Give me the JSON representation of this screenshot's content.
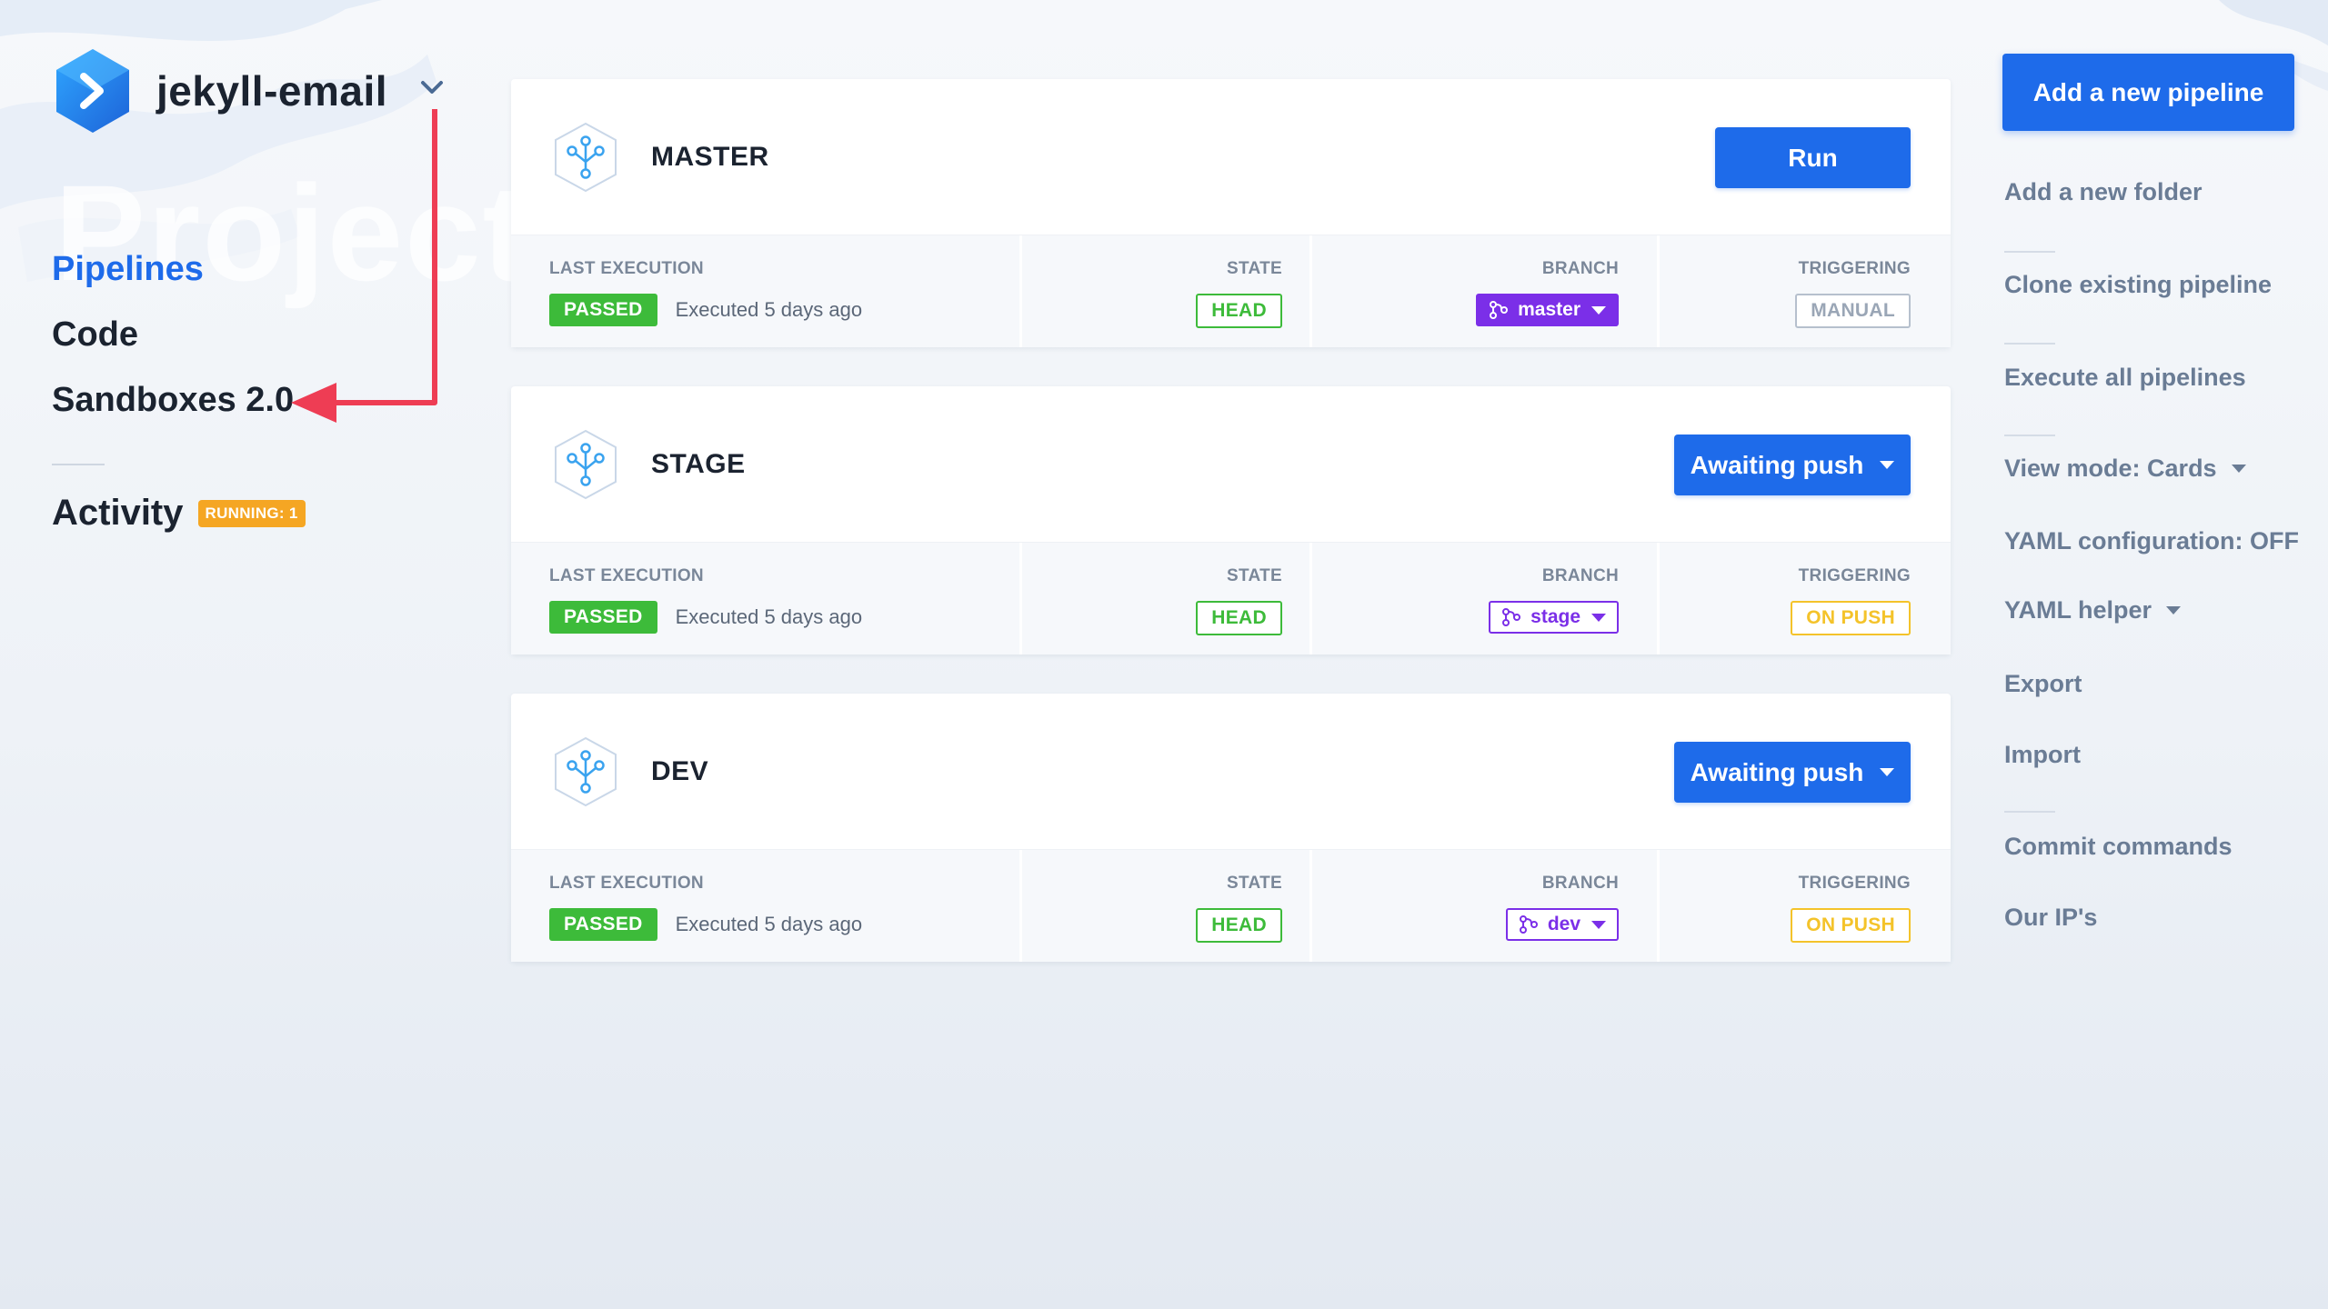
{
  "project": {
    "name": "jekyll-email",
    "watermark": "Project"
  },
  "nav": {
    "items": [
      {
        "label": "Pipelines",
        "active": true
      },
      {
        "label": "Code",
        "active": false
      },
      {
        "label": "Sandboxes 2.0",
        "active": false
      }
    ],
    "activity": {
      "label": "Activity",
      "badge": "RUNNING: 1"
    }
  },
  "pipelines": [
    {
      "name": "MASTER",
      "action": "Run",
      "last_execution_label": "LAST EXECUTION",
      "status": "PASSED",
      "executed": "Executed 5 days ago",
      "state_label": "STATE",
      "state": "HEAD",
      "branch_label": "BRANCH",
      "branch": "master",
      "triggering_label": "TRIGGERING",
      "triggering": "MANUAL"
    },
    {
      "name": "STAGE",
      "action": "Awaiting push",
      "last_execution_label": "LAST EXECUTION",
      "status": "PASSED",
      "executed": "Executed 5 days ago",
      "state_label": "STATE",
      "state": "HEAD",
      "branch_label": "BRANCH",
      "branch": "stage",
      "triggering_label": "TRIGGERING",
      "triggering": "ON PUSH"
    },
    {
      "name": "DEV",
      "action": "Awaiting push",
      "last_execution_label": "LAST EXECUTION",
      "status": "PASSED",
      "executed": "Executed 5 days ago",
      "state_label": "STATE",
      "state": "HEAD",
      "branch_label": "BRANCH",
      "branch": "dev",
      "triggering_label": "TRIGGERING",
      "triggering": "ON PUSH"
    }
  ],
  "sidebar_right": {
    "add_pipeline": "Add a new pipeline",
    "items": [
      "Add a new folder",
      "Clone existing pipeline",
      "Execute all pipelines",
      "View mode: Cards",
      "YAML configuration: OFF",
      "YAML helper",
      "Export",
      "Import",
      "Commit commands",
      "Our IP's"
    ]
  },
  "colors": {
    "primary": "#1e6bea",
    "passed": "#3dbb3a",
    "branch": "#7b2fe8",
    "on_push": "#f4c32a",
    "badge": "#f5a623",
    "arrow": "#ee3d54"
  },
  "icons": [
    "project-logo-icon",
    "chevron-down-icon",
    "pipeline-icon",
    "branch-icon",
    "caret-down-icon"
  ]
}
